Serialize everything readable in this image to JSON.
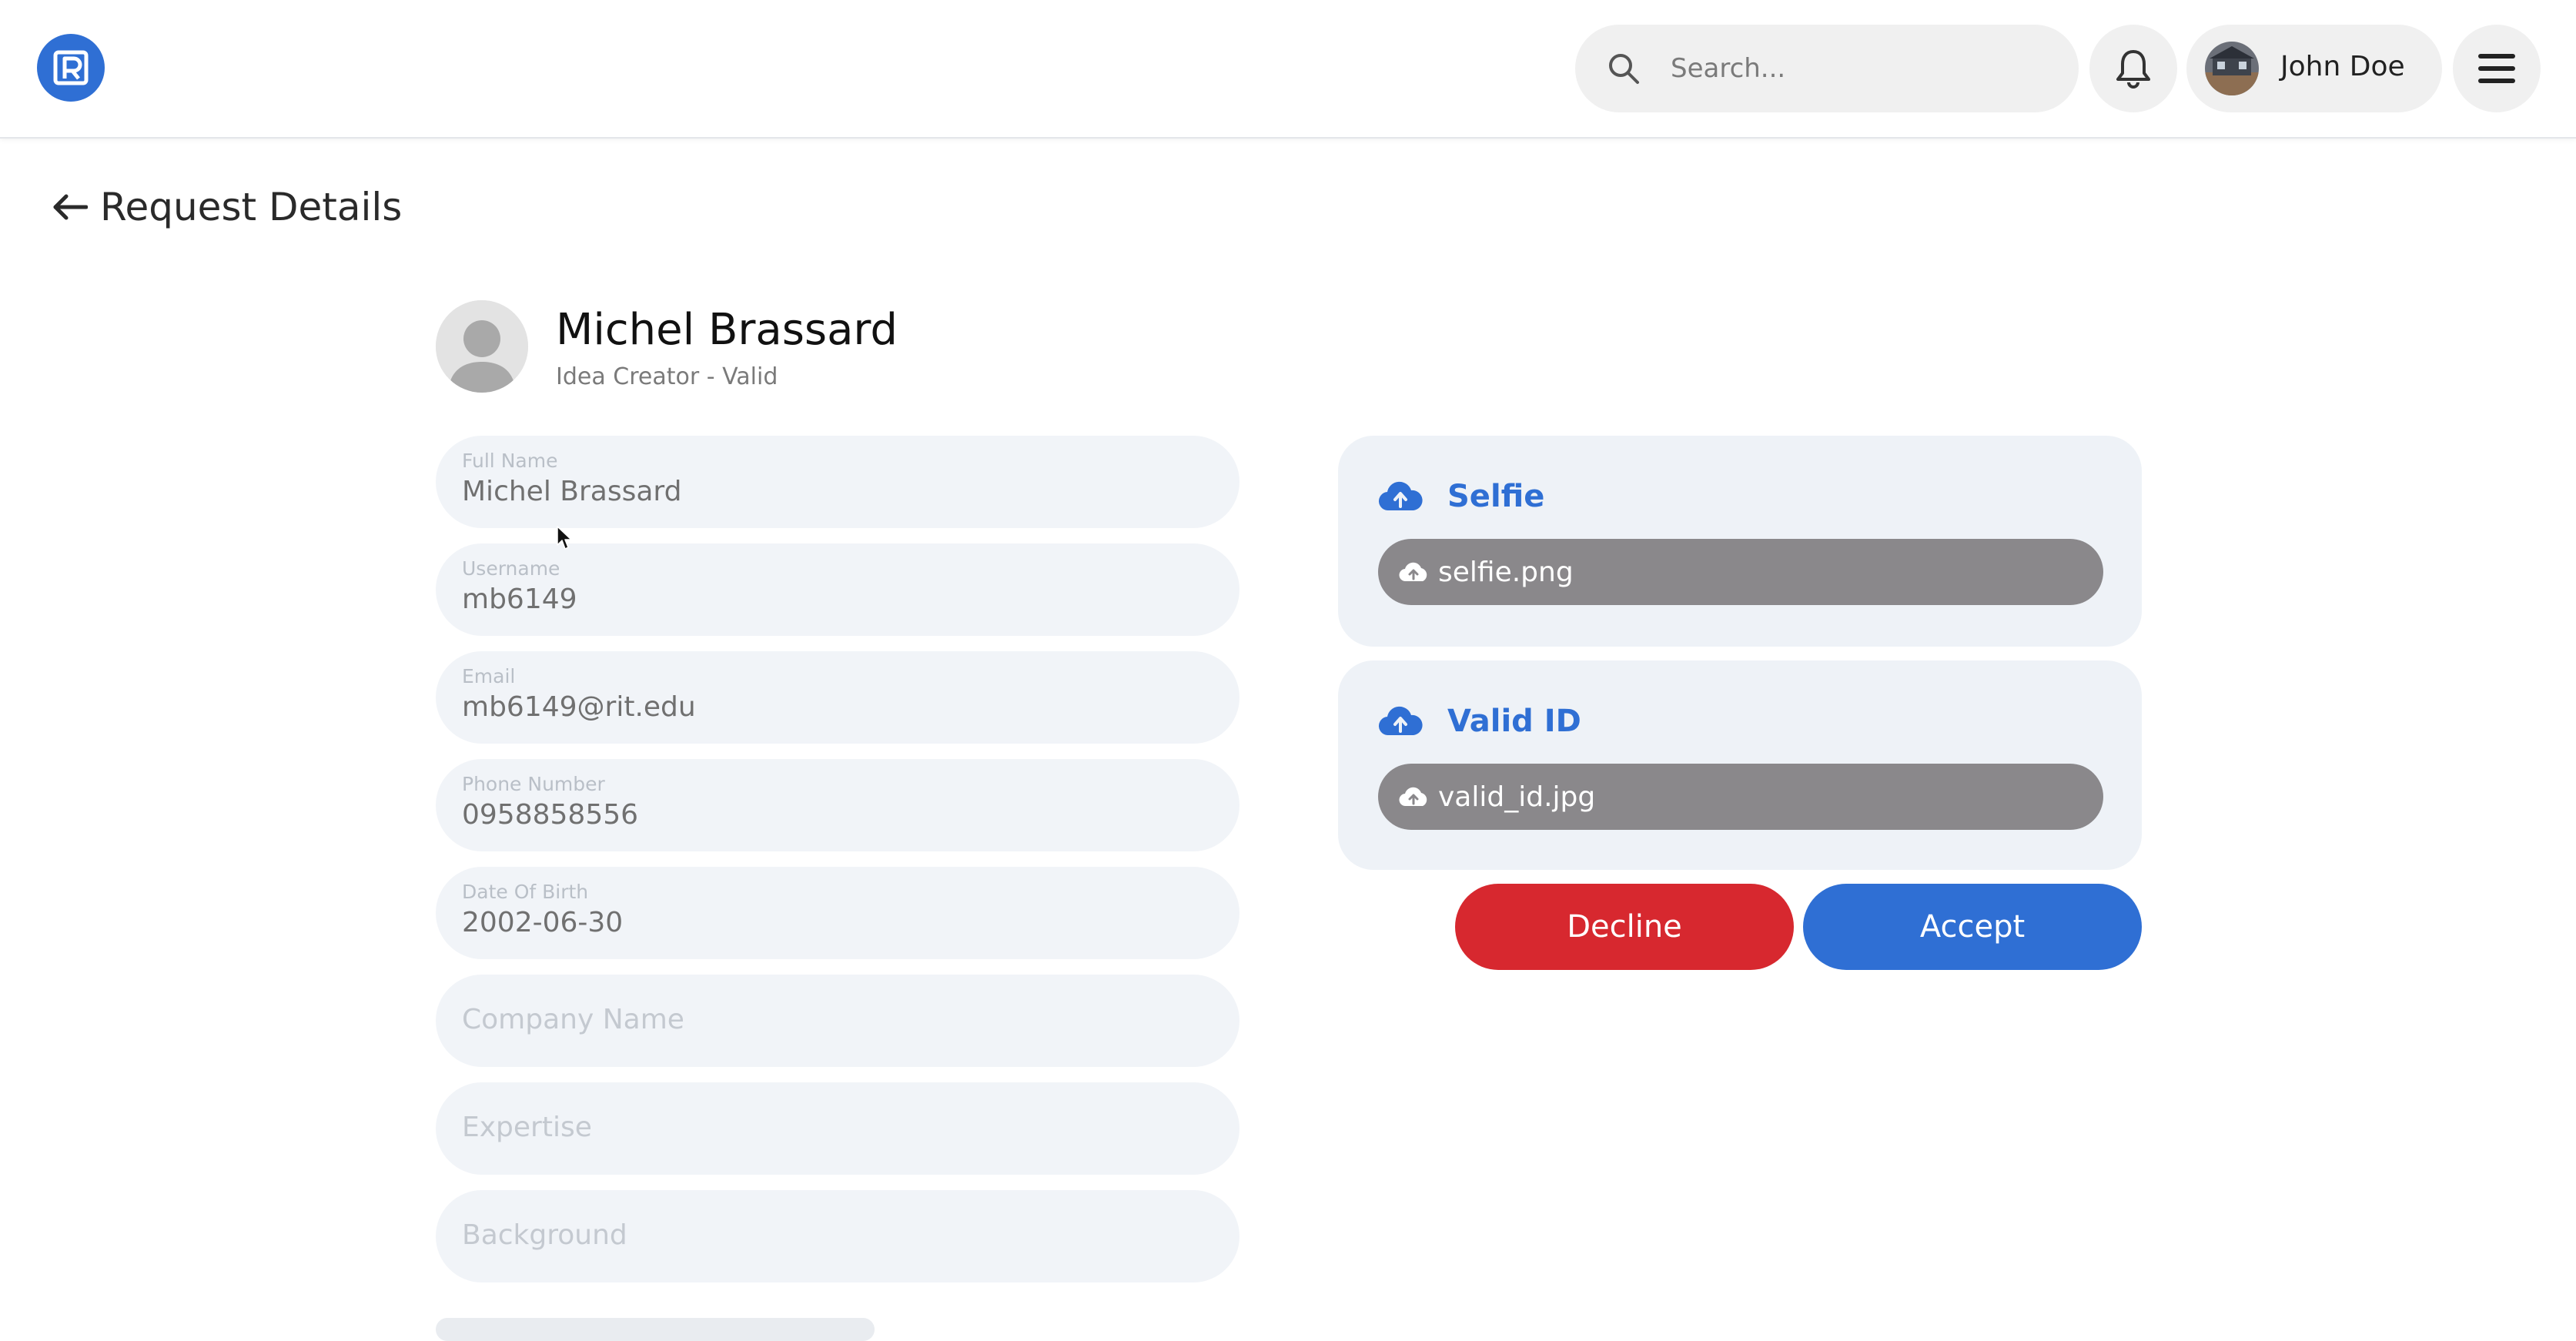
{
  "header": {
    "search_placeholder": "Search...",
    "user_name": "John Doe",
    "icons": {
      "logo": "app-logo",
      "search": "search-icon",
      "bell": "bell-icon",
      "menu": "hamburger-menu-icon"
    }
  },
  "page": {
    "title": "Request Details"
  },
  "profile": {
    "name": "Michel Brassard",
    "role": "Idea Creator - Valid"
  },
  "fields": [
    {
      "label": "Full Name",
      "value": "Michel Brassard"
    },
    {
      "label": "Username",
      "value": "mb6149"
    },
    {
      "label": "Email",
      "value": "mb6149@rit.edu"
    },
    {
      "label": "Phone Number",
      "value": "0958858556"
    },
    {
      "label": "Date Of Birth",
      "value": "2002-06-30"
    },
    {
      "placeholder": "Company Name"
    },
    {
      "placeholder": "Expertise"
    },
    {
      "placeholder": "Background"
    }
  ],
  "uploads": {
    "selfie": {
      "title": "Selfie",
      "file": "selfie.png"
    },
    "valid_id": {
      "title": "Valid ID",
      "file": "valid_id.jpg"
    }
  },
  "actions": {
    "decline": "Decline",
    "accept": "Accept"
  },
  "colors": {
    "primary": "#2f6fd4",
    "danger": "#d7282f",
    "field_bg": "#f1f4f8",
    "file_chip": "#8a888b"
  }
}
